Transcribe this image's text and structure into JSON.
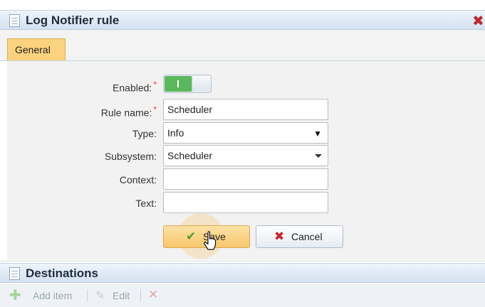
{
  "dialog": {
    "title": "Log Notifier rule",
    "close_icon": "close-icon",
    "tabs": [
      {
        "label": "General",
        "active": true
      }
    ]
  },
  "form": {
    "enabled": {
      "label": "Enabled:",
      "required": "*",
      "value": true,
      "on_text": "I"
    },
    "rule_name": {
      "label": "Rule name:",
      "required": "*",
      "value": "Scheduler"
    },
    "type": {
      "label": "Type:",
      "value": "Info",
      "caret": "▼"
    },
    "subsystem": {
      "label": "Subsystem:",
      "value": "Scheduler"
    },
    "context": {
      "label": "Context:",
      "value": ""
    },
    "text": {
      "label": "Text:",
      "value": ""
    }
  },
  "buttons": {
    "save": {
      "label": "Save",
      "icon": "checkmark-icon",
      "glyph": "✔"
    },
    "cancel": {
      "label": "Cancel",
      "icon": "cross-icon",
      "glyph": "✖"
    }
  },
  "destinations": {
    "title": "Destinations",
    "toolbar": {
      "add_label": "Add item",
      "add_glyph": "✚",
      "edit_label": "Edit",
      "edit_glyph": "✎",
      "delete_glyph": "✕"
    }
  },
  "colors": {
    "accent_tab": "#fbd27e",
    "toggle_on": "#5cb85c",
    "required": "#e33333",
    "close": "#c0262d"
  }
}
